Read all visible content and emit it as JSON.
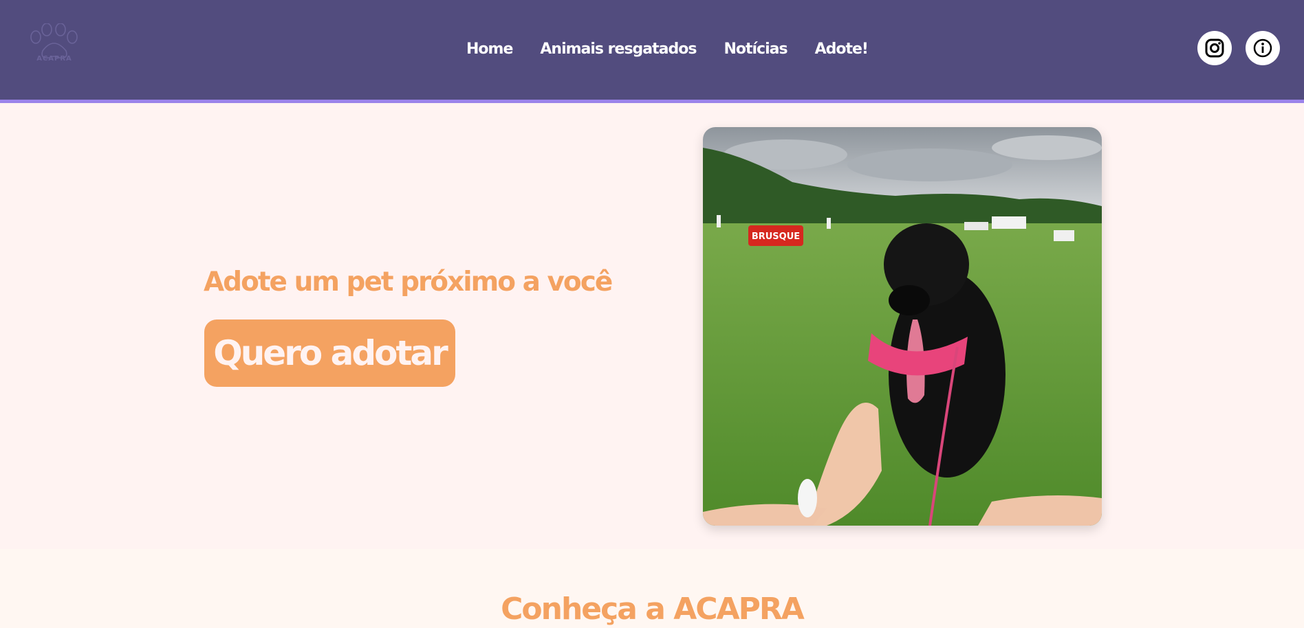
{
  "header": {
    "logo_text": "ACAPRA",
    "nav": [
      "Home",
      "Animais resgatados",
      "Notícias",
      "Adote!"
    ],
    "social": [
      "instagram-icon",
      "info-icon"
    ]
  },
  "hero": {
    "title": "Adote um pet próximo a você",
    "cta_label": "Quero adotar",
    "photo_sign": "BRUSQUE"
  },
  "about": {
    "title": "Conheça a ACAPRA"
  },
  "colors": {
    "header_bg": "#524c7e",
    "header_border": "#9b83ea",
    "accent_orange": "#f4a261",
    "page_bg": "#fff3f2"
  }
}
